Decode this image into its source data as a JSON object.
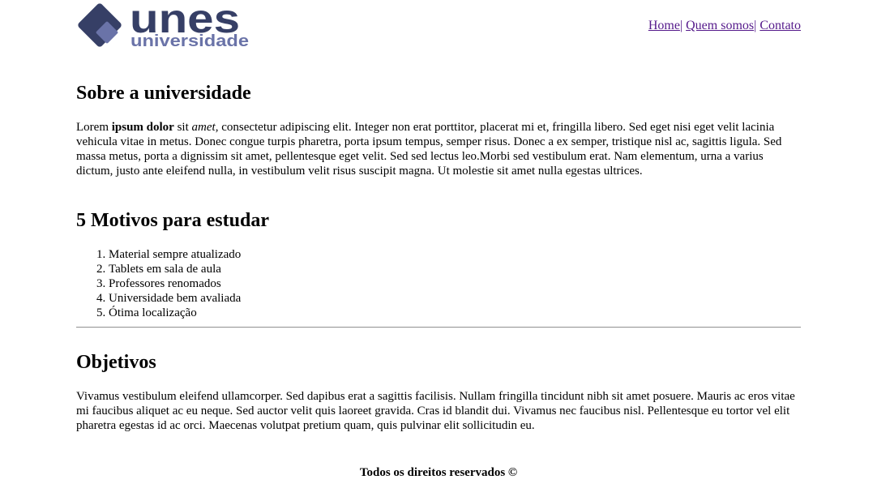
{
  "header": {
    "logo": {
      "name": "unes",
      "tagline": "universidade",
      "brand_color": "#363f66",
      "accent_color": "#6a73a8"
    },
    "nav": [
      {
        "label": "Home"
      },
      {
        "label": "Quem somos"
      },
      {
        "label": "Contato"
      }
    ],
    "nav_separator": "|"
  },
  "sections": {
    "about": {
      "title": "Sobre a universidade",
      "text_start": "Lorem ",
      "text_bold": "ipsum dolor",
      "text_mid": " sit ",
      "text_italic": "amet",
      "text_rest": ", consectetur adipiscing elit. Integer non erat porttitor, placerat mi et, fringilla libero. Sed eget nisi eget velit lacinia vehicula vitae in metus. Donec congue turpis pharetra, porta ipsum tempus, semper risus. Donec a ex semper, tristique nisl ac, sagittis ligula. Sed massa metus, porta a dignissim sit amet, pellentesque eget velit. Sed sed lectus leo.Morbi sed vestibulum erat. Nam elementum, urna a varius dictum, justo ante eleifend nulla, in vestibulum velit risus suscipit magna. Ut molestie sit amet nulla egestas ultrices."
    },
    "reasons": {
      "title": "5 Motivos para estudar",
      "items": [
        "Material sempre atualizado",
        "Tablets em sala de aula",
        "Professores renomados",
        "Universidade bem avaliada",
        "Ótima localização"
      ]
    },
    "goals": {
      "title": "Objetivos",
      "text": "Vivamus vestibulum eleifend ullamcorper. Sed dapibus erat a sagittis facilisis. Nullam fringilla tincidunt nibh sit amet posuere. Mauris ac eros vitae mi faucibus aliquet ac eu neque. Sed auctor velit quis laoreet gravida. Cras id blandit dui. Vivamus nec faucibus nisl. Pellentesque eu tortor vel elit pharetra egestas id ac orci. Maecenas volutpat pretium quam, quis pulvinar elit sollicitudin eu."
    }
  },
  "footer": {
    "text": "Todos os direitos reservados ©"
  }
}
